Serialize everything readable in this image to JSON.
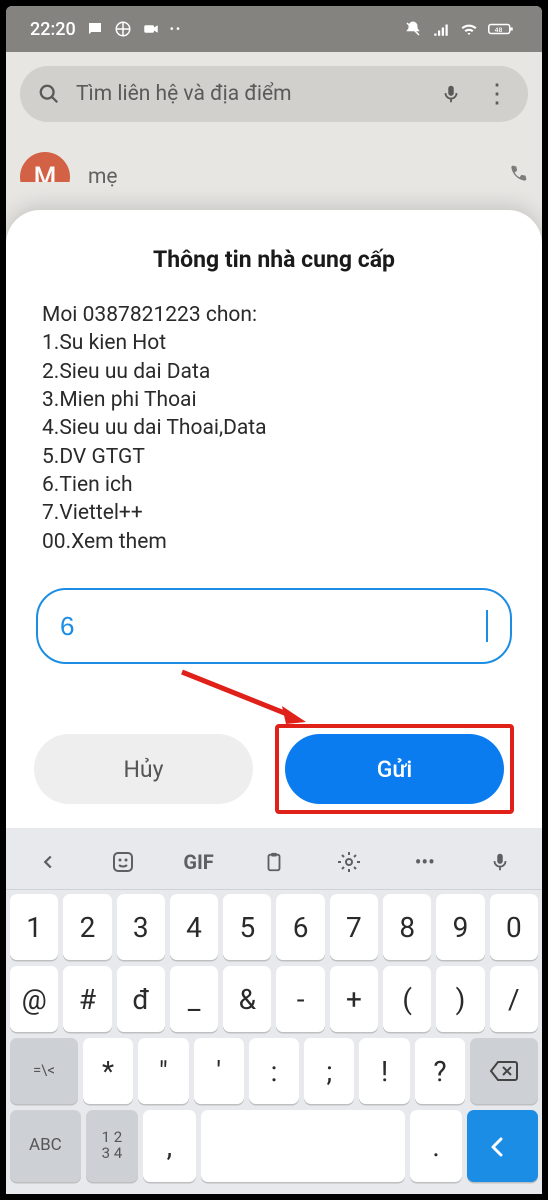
{
  "status": {
    "time": "22:20"
  },
  "search": {
    "placeholder": "Tìm liên hệ và địa điểm"
  },
  "contact": {
    "name": "mẹ",
    "initial": "M"
  },
  "modal": {
    "title": "Thông tin nhà cung cấp",
    "lines": [
      "Moi 0387821223 chon:",
      "1.Su kien Hot",
      "2.Sieu uu dai Data",
      "3.Mien phi Thoai",
      "4.Sieu uu dai Thoai,Data",
      "5.DV GTGT",
      "6.Tien ich",
      "7.Viettel++",
      "00.Xem them"
    ],
    "input_value": "6",
    "cancel": "Hủy",
    "send": "Gửi"
  },
  "keyboard": {
    "top": {
      "gif": "GIF",
      "more": "•••"
    },
    "row1": [
      "1",
      "2",
      "3",
      "4",
      "5",
      "6",
      "7",
      "8",
      "9",
      "0"
    ],
    "row2": [
      "@",
      "#",
      "đ",
      "_",
      "&",
      "-",
      "+",
      "(",
      ")",
      "/"
    ],
    "row3_shift": "=\\<",
    "row3": [
      "*",
      "\"",
      "'",
      ":",
      ";",
      "!",
      "?"
    ],
    "row4_mode": "ABC",
    "row4_num": "1 2\n3 4",
    "row4_syms": [
      ",",
      "."
    ]
  }
}
